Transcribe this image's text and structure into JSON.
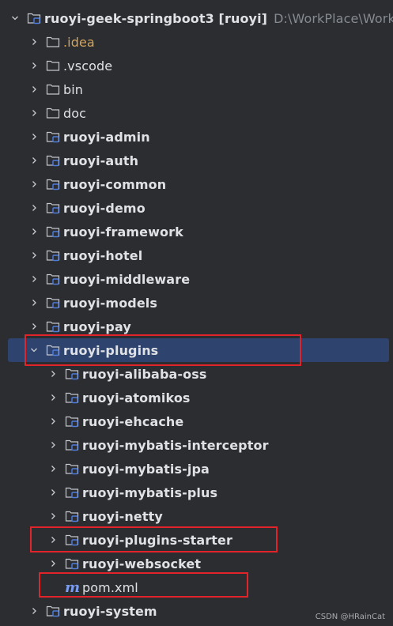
{
  "tree": {
    "root": {
      "label": "ruoyi-geek-springboot3 [ruoyi]",
      "path": "D:\\WorkPlace\\Works\\Gr",
      "expanded": true
    },
    "level1_before": [
      {
        "label": ".idea",
        "kind": "folder",
        "style": "orange"
      },
      {
        "label": ".vscode",
        "kind": "folder",
        "style": "plain"
      },
      {
        "label": "bin",
        "kind": "folder",
        "style": "plain"
      },
      {
        "label": "doc",
        "kind": "folder",
        "style": "plain"
      },
      {
        "label": "ruoyi-admin",
        "kind": "module",
        "style": "bold"
      },
      {
        "label": "ruoyi-auth",
        "kind": "module",
        "style": "bold"
      },
      {
        "label": "ruoyi-common",
        "kind": "module",
        "style": "bold"
      },
      {
        "label": "ruoyi-demo",
        "kind": "module",
        "style": "bold"
      },
      {
        "label": "ruoyi-framework",
        "kind": "module",
        "style": "bold"
      },
      {
        "label": "ruoyi-hotel",
        "kind": "module",
        "style": "bold"
      },
      {
        "label": "ruoyi-middleware",
        "kind": "module",
        "style": "bold"
      },
      {
        "label": "ruoyi-models",
        "kind": "module",
        "style": "bold"
      },
      {
        "label": "ruoyi-pay",
        "kind": "module",
        "style": "bold"
      }
    ],
    "plugins": {
      "label": "ruoyi-plugins",
      "expanded": true,
      "selected": true
    },
    "plugins_children": [
      {
        "label": "ruoyi-alibaba-oss"
      },
      {
        "label": "ruoyi-atomikos"
      },
      {
        "label": "ruoyi-ehcache"
      },
      {
        "label": "ruoyi-mybatis-interceptor"
      },
      {
        "label": "ruoyi-mybatis-jpa"
      },
      {
        "label": "ruoyi-mybatis-plus"
      },
      {
        "label": "ruoyi-netty"
      },
      {
        "label": "ruoyi-plugins-starter"
      },
      {
        "label": "ruoyi-websocket"
      }
    ],
    "pom": {
      "label": "pom.xml",
      "icon": "maven-m-icon"
    },
    "system": {
      "label": "ruoyi-system"
    }
  },
  "watermark": "CSDN @HRainCat",
  "colors": {
    "background": "#2b2d30",
    "selection": "#2e436e",
    "highlight_box": "#e0242a",
    "folder_stroke": "#c3c6cc",
    "module_badge": "#4d7ce0"
  }
}
